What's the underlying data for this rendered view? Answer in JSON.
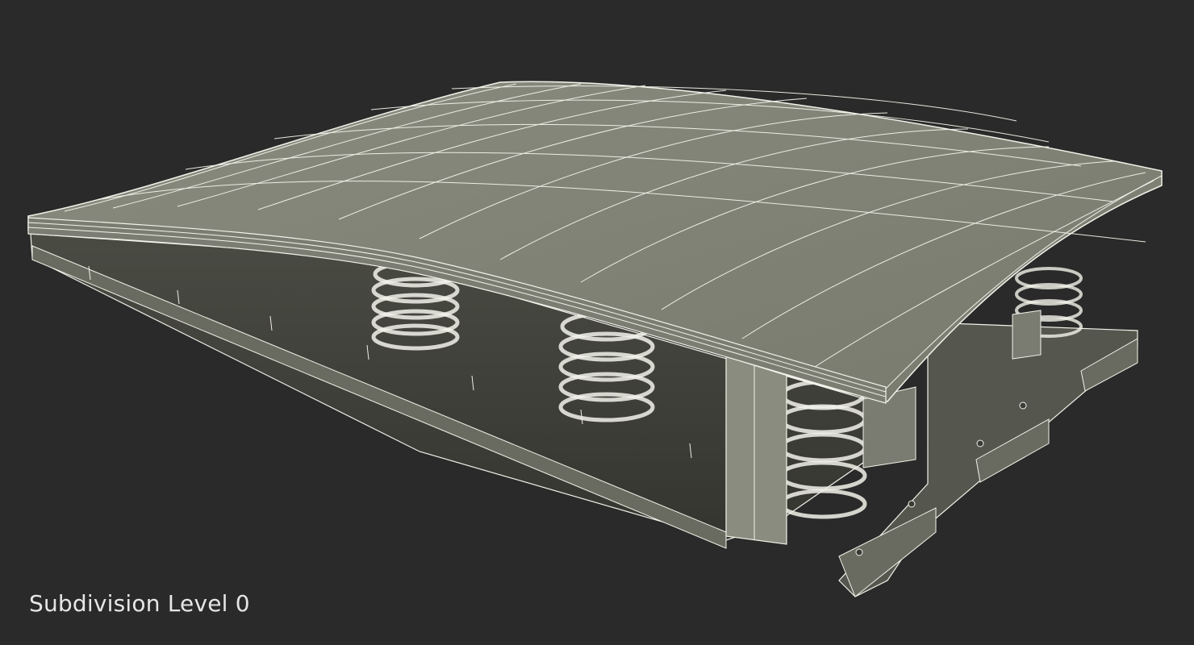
{
  "caption": "Subdivision Level 0",
  "colors": {
    "background": "#2a2a2a",
    "surface": "#86877a",
    "surface_dark": "#5f6056",
    "under_shadow": "#3e3f38",
    "wire": "#f2f2ea",
    "caption_text": "#e6e6e6"
  },
  "render": {
    "subject": "springboard",
    "style": "wireframe-on-shaded"
  }
}
